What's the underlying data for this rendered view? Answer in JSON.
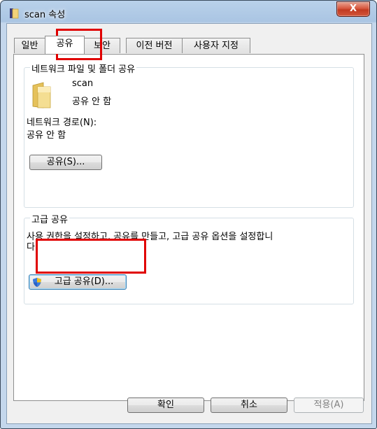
{
  "window": {
    "title": "scan 속성",
    "close_label": "X"
  },
  "tabs": [
    {
      "label": "일반"
    },
    {
      "label": "공유"
    },
    {
      "label": "보안"
    },
    {
      "label": "이전 버전"
    },
    {
      "label": "사용자 지정"
    }
  ],
  "network_share": {
    "legend": "네트워크 파일 및 폴더 공유",
    "folder_name": "scan",
    "folder_status": "공유 안 함",
    "path_label": "네트워크 경로(N):",
    "path_value": "공유 안 함",
    "share_button": "공유(S)..."
  },
  "advanced_share": {
    "legend": "고급 공유",
    "description_line1": "사용 권한을 설정하고, 공유를 만들고, 고급 공유 옵션을 설정합니",
    "description_line2": "다.",
    "button": "고급 공유(D)..."
  },
  "footer": {
    "ok": "확인",
    "cancel": "취소",
    "apply": "적용(A)"
  },
  "colors": {
    "highlight": "#e00000",
    "close_button": "#c13a21"
  }
}
